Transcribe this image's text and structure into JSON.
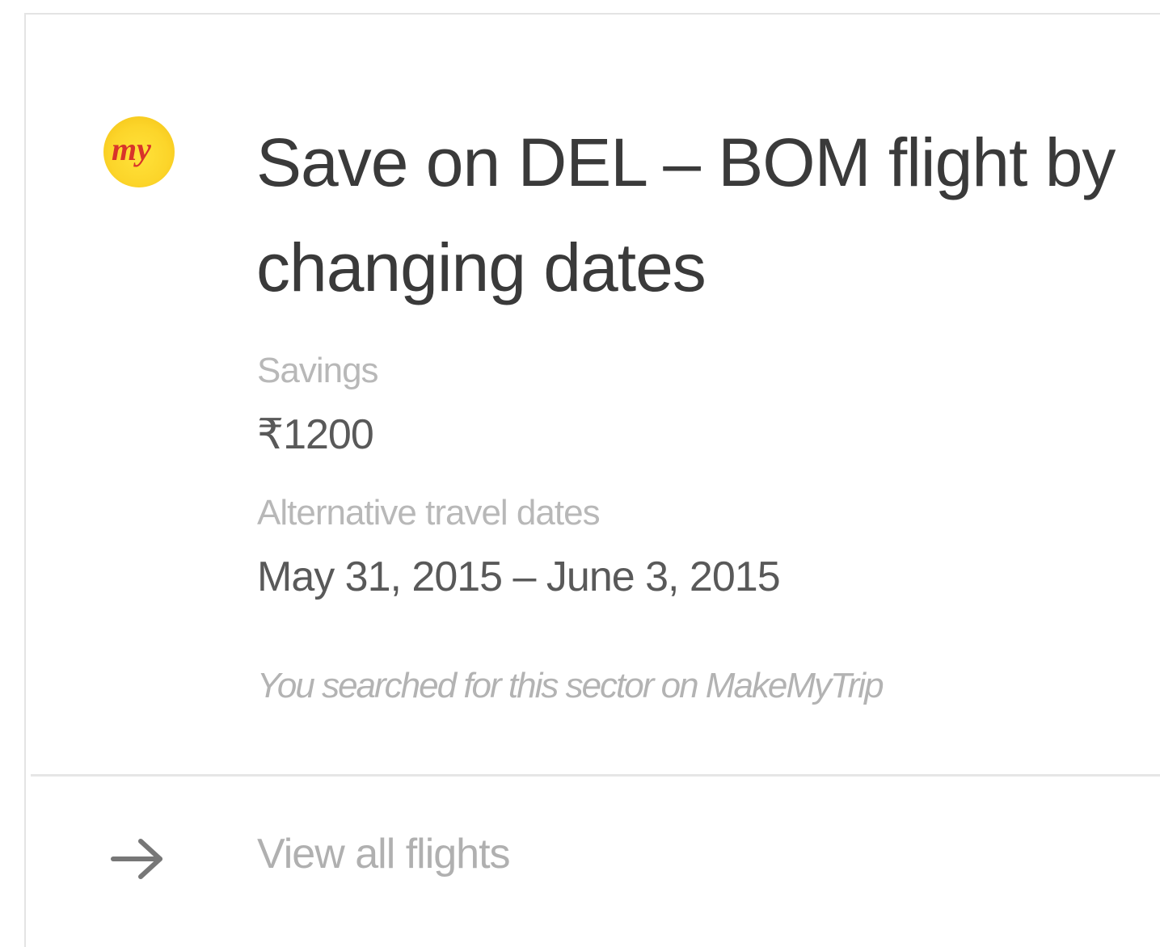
{
  "card": {
    "logo": {
      "icon": "makemytrip-logo-icon",
      "text": "my",
      "color_bg": "#fcd52a",
      "color_text": "#d8342a"
    },
    "title": "Save on DEL – BOM flight by changing dates",
    "savings": {
      "label": "Savings",
      "value": "₹1200"
    },
    "dates": {
      "label": "Alternative travel dates",
      "value": "May 31, 2015 – June 3, 2015"
    },
    "note": "You searched for this sector on MakeMyTrip",
    "footer": {
      "icon": "arrow-right-icon",
      "label": "View all flights"
    }
  }
}
